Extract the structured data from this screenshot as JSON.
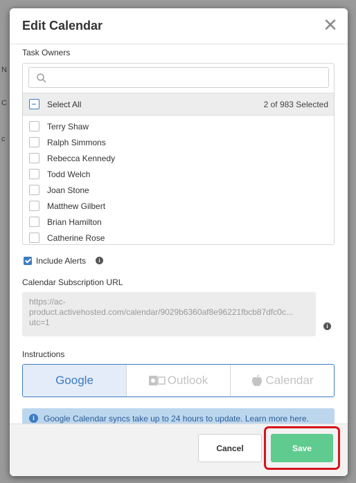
{
  "background": {
    "partial_text": [
      "N",
      "C",
      "c"
    ]
  },
  "modal": {
    "title": "Edit Calendar",
    "close_glyph": "✕"
  },
  "task_owners": {
    "label": "Task Owners",
    "search_placeholder": "",
    "select_all_label": "Select All",
    "selected_count": "2 of 983 Selected",
    "owners": [
      {
        "name": "Terry Shaw",
        "checked": false
      },
      {
        "name": "Ralph Simmons",
        "checked": false
      },
      {
        "name": "Rebecca Kennedy",
        "checked": false
      },
      {
        "name": "Todd Welch",
        "checked": false
      },
      {
        "name": "Joan Stone",
        "checked": false
      },
      {
        "name": "Matthew Gilbert",
        "checked": false
      },
      {
        "name": "Brian Hamilton",
        "checked": false
      },
      {
        "name": "Catherine Rose",
        "checked": false
      }
    ]
  },
  "alerts": {
    "label": "Include Alerts",
    "checked": true
  },
  "subscription": {
    "label": "Calendar Subscription URL",
    "url_lines": [
      "https://ac-",
      "product.activehosted.com/calendar/9029b6360af8e96221fbcb87dfc0c...",
      "utc=1"
    ]
  },
  "instructions": {
    "label": "Instructions",
    "tabs": [
      "Google",
      "Outlook",
      "Calendar"
    ],
    "active_tab": "Google",
    "banner_text": "Google Calendar syncs take up to 24 hours to update. Learn more here."
  },
  "footer": {
    "cancel_label": "Cancel",
    "save_label": "Save"
  },
  "colors": {
    "accent": "#3d7bc2",
    "save": "#5fcb8f",
    "highlight": "#d5141b"
  }
}
